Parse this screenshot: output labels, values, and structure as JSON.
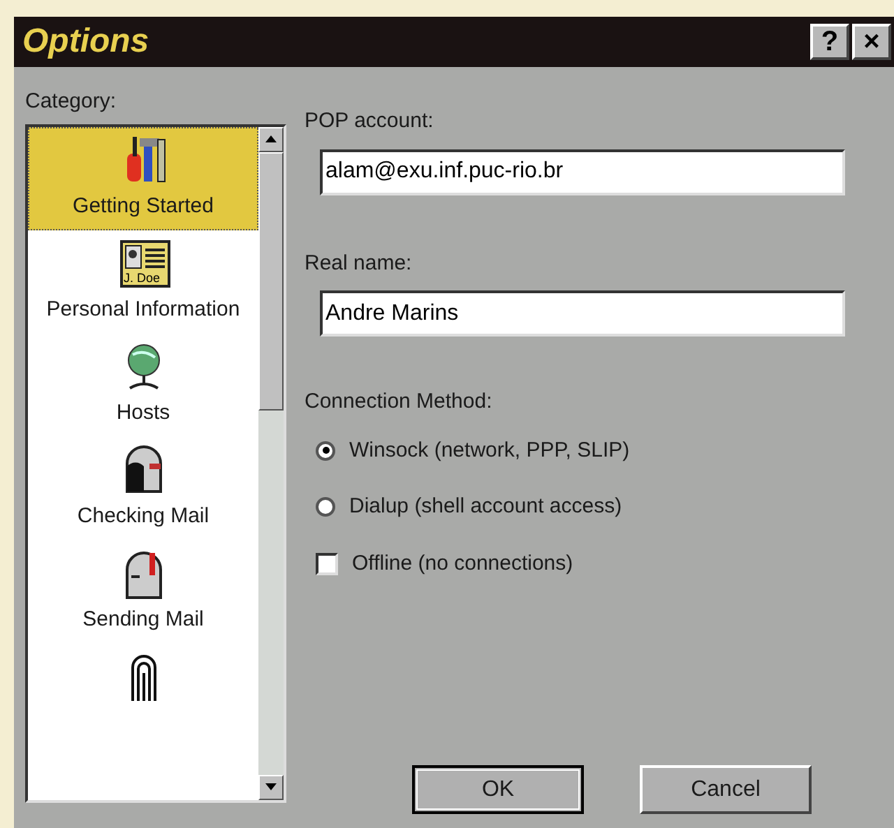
{
  "window": {
    "title": "Options",
    "title_buttons": [
      "?",
      "×"
    ]
  },
  "category": {
    "label": "Category:",
    "items": [
      {
        "kind": "tools",
        "label": "Getting Started",
        "selected": true
      },
      {
        "kind": "card",
        "label": "Personal Information",
        "card_text": "J. Doe",
        "selected": false
      },
      {
        "kind": "globe",
        "label": "Hosts",
        "selected": false
      },
      {
        "kind": "mailbox-open",
        "label": "Checking Mail",
        "selected": false
      },
      {
        "kind": "mailbox-flag",
        "label": "Sending Mail",
        "selected": false
      },
      {
        "kind": "clip",
        "selected": false
      }
    ]
  },
  "fields": [
    {
      "label": "POP account:",
      "value": "alam@exu.inf.puc-rio.br"
    },
    {
      "label": "Real name:",
      "value": "Andre Marins"
    }
  ],
  "connection": {
    "label": "Connection Method:",
    "options": [
      {
        "kind": "radio",
        "label": "Winsock (network, PPP, SLIP)",
        "selected": true
      },
      {
        "kind": "radio",
        "label": "Dialup (shell account access)",
        "selected": false
      },
      {
        "kind": "checkbox",
        "label": "Offline (no connections)",
        "checked": false
      }
    ]
  },
  "buttons": [
    "OK",
    "Cancel"
  ]
}
